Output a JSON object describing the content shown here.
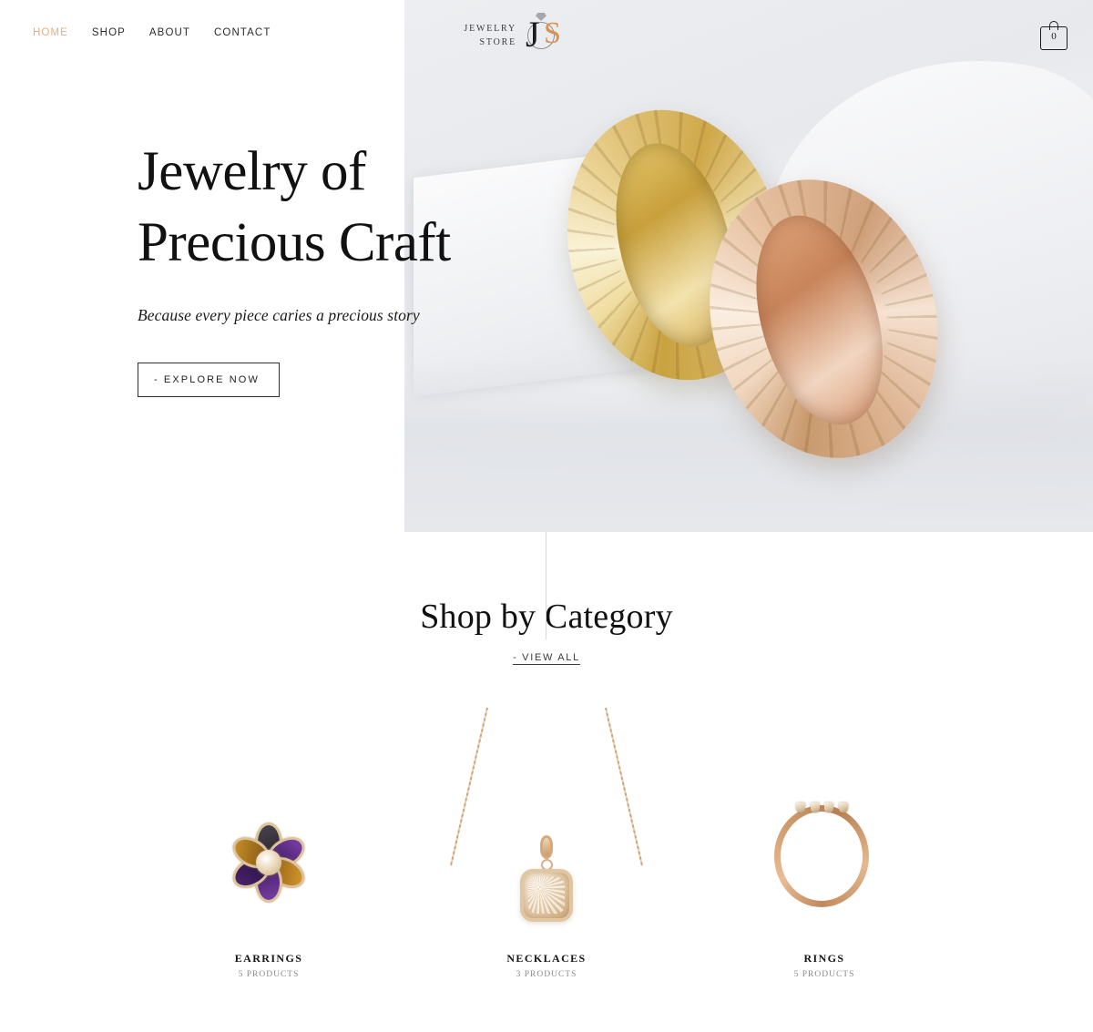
{
  "header": {
    "nav": [
      {
        "label": "HOME",
        "active": true
      },
      {
        "label": "SHOP",
        "active": false
      },
      {
        "label": "ABOUT",
        "active": false
      },
      {
        "label": "CONTACT",
        "active": false
      }
    ],
    "logo": {
      "line1": "JEWELRY",
      "line2": "STORE",
      "monogram_j": "J",
      "monogram_s": "S"
    },
    "cart": {
      "count": "0",
      "icon": "shopping-bag-icon"
    },
    "accent_color": "#e0b083"
  },
  "hero": {
    "title_line1": "Jewelry of",
    "title_line2": "Precious Craft",
    "subtitle": "Because every piece caries a precious story",
    "cta_label": "- EXPLORE NOW",
    "image_alt": "two engraved gold wedding bands"
  },
  "categories_section": {
    "title": "Shop by Category",
    "view_all_label": "- VIEW ALL",
    "items": [
      {
        "name": "EARRINGS",
        "count": "5 PRODUCTS",
        "image_alt": "flower shaped gemstone earring"
      },
      {
        "name": "NECKLACES",
        "count": "3 PRODUCTS",
        "image_alt": "gold chain necklace with pave pendant"
      },
      {
        "name": "RINGS",
        "count": "5 PRODUCTS",
        "image_alt": "rose gold ring with small stones"
      }
    ]
  }
}
